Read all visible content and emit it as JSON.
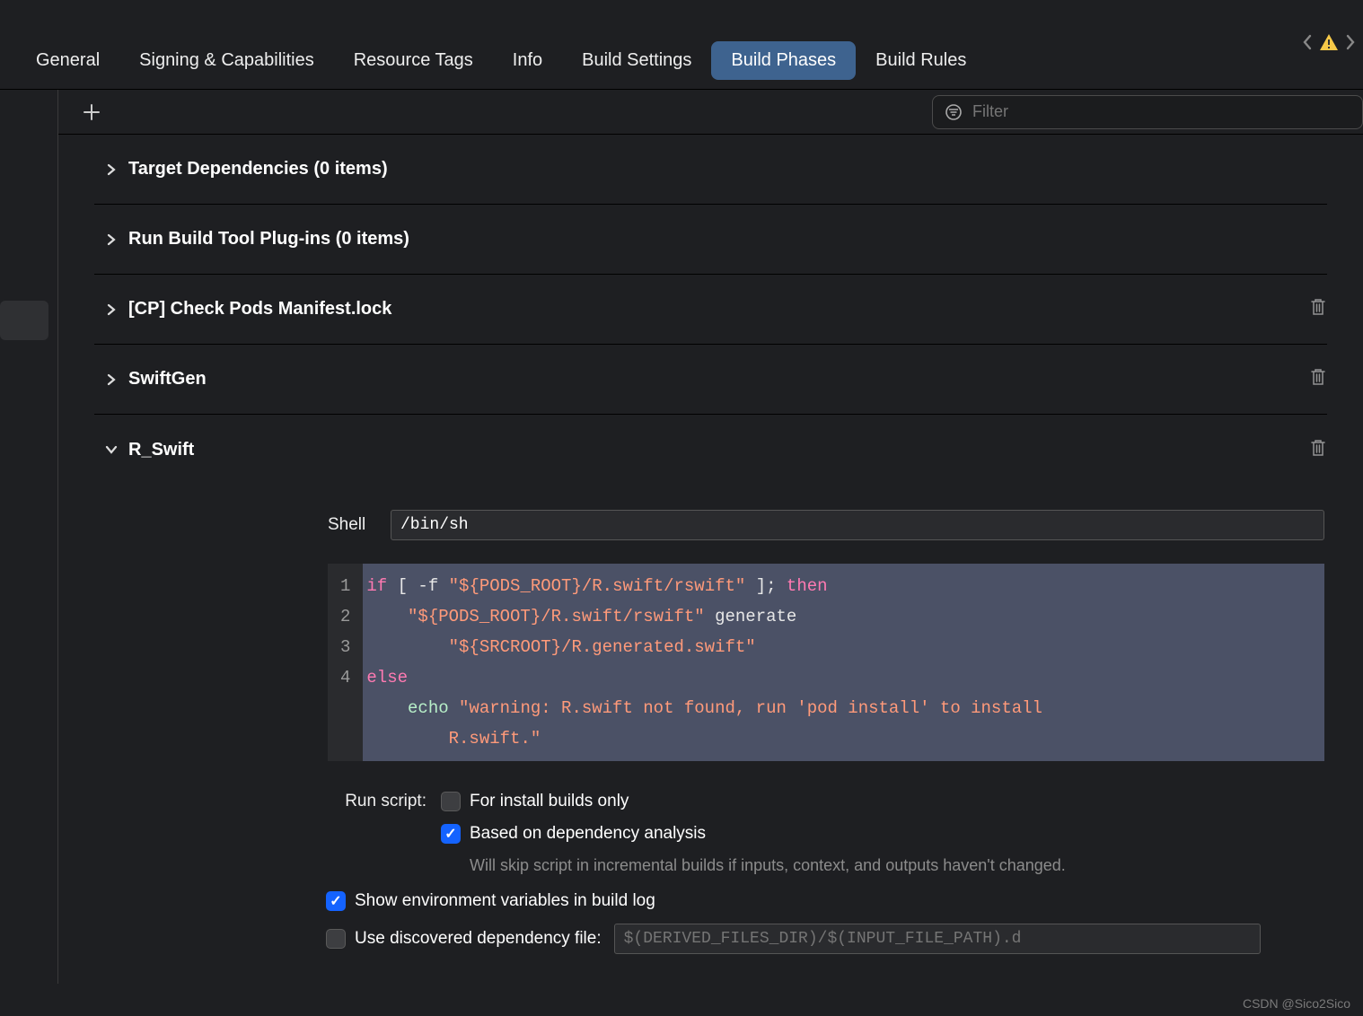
{
  "tabs": {
    "general": "General",
    "signing": "Signing & Capabilities",
    "resource": "Resource Tags",
    "info": "Info",
    "build_settings": "Build Settings",
    "build_phases": "Build Phases",
    "build_rules": "Build Rules"
  },
  "filter": {
    "placeholder": "Filter"
  },
  "phases": {
    "target_deps": "Target Dependencies (0 items)",
    "plugins": "Run Build Tool Plug-ins (0 items)",
    "cp_pods": "[CP] Check Pods Manifest.lock",
    "swiftgen": "SwiftGen",
    "rswift": "R_Swift"
  },
  "shell": {
    "label": "Shell",
    "value": "/bin/sh"
  },
  "script": {
    "lines": [
      "1",
      "2",
      "",
      "3",
      "4",
      ""
    ],
    "l1_kw_if": "if",
    "l1_plain_a": " [ -f ",
    "l1_str_a": "\"${PODS_ROOT}",
    "l1_str_b": "/R.swift/rswift\"",
    "l1_plain_b": " ]; ",
    "l1_kw_then": "then",
    "l2_pad": "    ",
    "l2_str_a": "\"${PODS_ROOT}",
    "l2_str_b": "/R.swift/rswift\"",
    "l2_plain": " generate",
    "l2b_pad": "        ",
    "l2b_str_a": "\"${SRCROOT}",
    "l2b_str_b": "/R.generated.swift\"",
    "l3_kw": "else",
    "l4_pad": "    ",
    "l4_fn": "echo",
    "l4_sp": " ",
    "l4_str_a": "\"warning: R.swift not found, run 'pod install' to install",
    "l4b_pad": "        ",
    "l4b_str": "R.swift.\""
  },
  "options": {
    "run_script_label": "Run script:",
    "install_only": "For install builds only",
    "dep_analysis": "Based on dependency analysis",
    "hint": "Will skip script in incremental builds if inputs, context, and outputs haven't changed.",
    "show_env": "Show environment variables in build log",
    "use_dep_file": "Use discovered dependency file:",
    "dep_file_placeholder": "$(DERIVED_FILES_DIR)/$(INPUT_FILE_PATH).d"
  },
  "watermark": "CSDN @Sico2Sico"
}
